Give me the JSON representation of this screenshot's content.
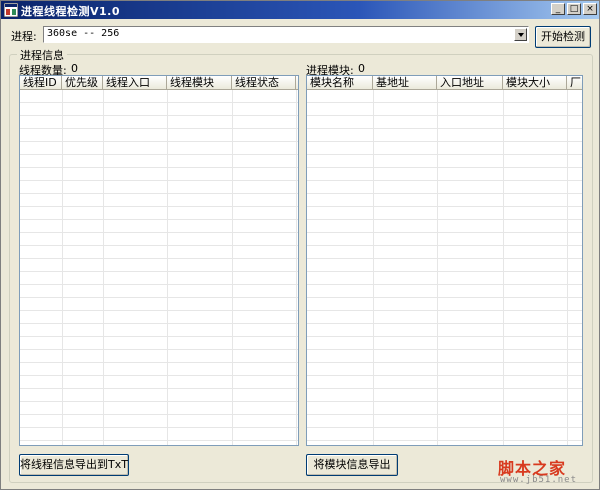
{
  "window": {
    "title": "进程线程检测V1.0",
    "minimize_glyph": "_",
    "maximize_glyph": "□",
    "close_glyph": "×"
  },
  "process": {
    "label": "进程:",
    "selected_value": "360se -- 256",
    "start_button": "开始检测"
  },
  "group": {
    "title": "进程信息"
  },
  "threads": {
    "count_label": "线程数量:",
    "count_value": "0",
    "columns": [
      "线程ID",
      "优先级",
      "线程入口",
      "线程模块",
      "线程状态"
    ],
    "export_button": "将线程信息导出到TxT"
  },
  "modules": {
    "count_label": "进程模块:",
    "count_value": "0",
    "columns": [
      "模块名称",
      "基地址",
      "入口地址",
      "模块大小",
      "厂"
    ],
    "export_button": "将模块信息导出"
  },
  "watermark": {
    "brand": "脚本之家",
    "url": "www.jb51.net"
  },
  "colors": {
    "title_bar": "#0a246a",
    "window_bg": "#ece9d8",
    "list_border": "#7f9db9",
    "watermark_red": "#d83a1f"
  }
}
